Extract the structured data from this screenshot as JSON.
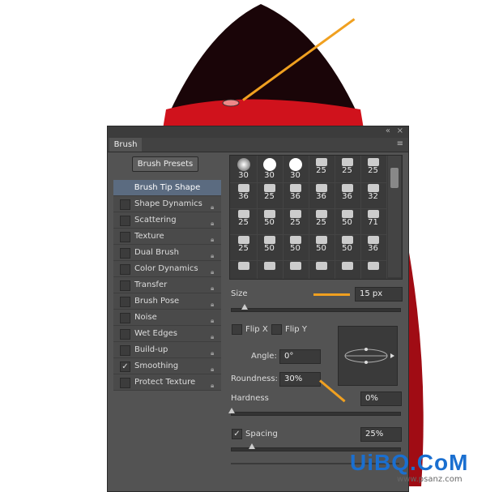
{
  "panel": {
    "tab": "Brush",
    "presets_button": "Brush Presets",
    "options": [
      {
        "label": "Brush Tip Shape",
        "selected": true
      },
      {
        "label": "Shape Dynamics",
        "checked": false,
        "lock": true
      },
      {
        "label": "Scattering",
        "checked": false,
        "lock": true
      },
      {
        "label": "Texture",
        "checked": false,
        "lock": true
      },
      {
        "label": "Dual Brush",
        "checked": false,
        "lock": true
      },
      {
        "label": "Color Dynamics",
        "checked": false,
        "lock": true
      },
      {
        "label": "Transfer",
        "checked": false,
        "lock": true
      },
      {
        "label": "Brush Pose",
        "checked": false,
        "lock": true
      },
      {
        "label": "Noise",
        "checked": false,
        "lock": true
      },
      {
        "label": "Wet Edges",
        "checked": false,
        "lock": true
      },
      {
        "label": "Build-up",
        "checked": false,
        "lock": true
      },
      {
        "label": "Smoothing",
        "checked": true,
        "lock": true
      },
      {
        "label": "Protect Texture",
        "checked": false,
        "lock": true
      }
    ],
    "brush_sizes": [
      30,
      30,
      30,
      25,
      25,
      25,
      36,
      25,
      36,
      36,
      36,
      32,
      25,
      50,
      25,
      25,
      50,
      71,
      25,
      50,
      50,
      50,
      50,
      36
    ],
    "size_label": "Size",
    "size_value": "15 px",
    "flip_x": "Flip X",
    "flip_y": "Flip Y",
    "angle_label": "Angle:",
    "angle_value": "0°",
    "roundness_label": "Roundness:",
    "roundness_value": "30%",
    "hardness_label": "Hardness",
    "hardness_value": "0%",
    "spacing_label": "Spacing",
    "spacing_value": "25%",
    "spacing_checked": true
  },
  "watermark": {
    "logo": "UiBQ.CoM",
    "url": "www.psanz.com"
  },
  "colors": {
    "accent": "#f0a020",
    "rocket": "#c8101a"
  }
}
